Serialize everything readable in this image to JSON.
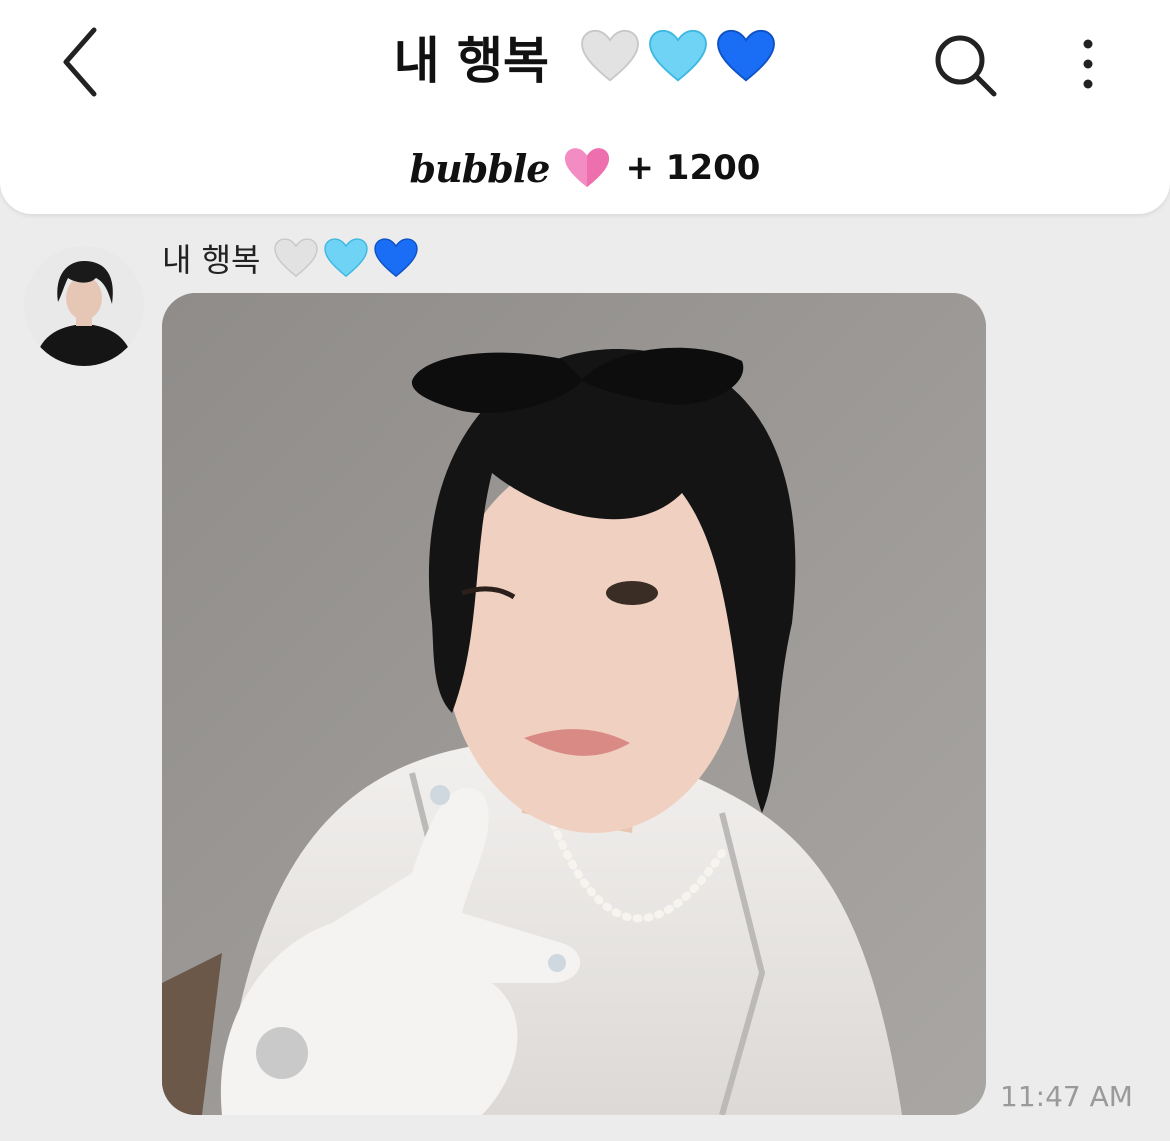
{
  "header": {
    "title": "내 행복",
    "title_hearts": [
      "white-heart",
      "light-blue-heart",
      "blue-heart"
    ],
    "bubble_logo": "bubble",
    "bubble_heart": "pink-heart",
    "plus_count": "+ 1200"
  },
  "message": {
    "sender_name": "내 행복",
    "sender_hearts": [
      "white-heart",
      "light-blue-heart",
      "blue-heart"
    ],
    "attachment": "photo",
    "time": "11:47 AM"
  },
  "colors": {
    "background": "#ececec",
    "header": "#ffffff",
    "white_heart": "#e2e2e2",
    "light_blue_heart": "#6fd3f5",
    "blue_heart": "#1a6df5",
    "pink_heart": "#f28cc3",
    "timestamp": "#9a9a9a"
  }
}
